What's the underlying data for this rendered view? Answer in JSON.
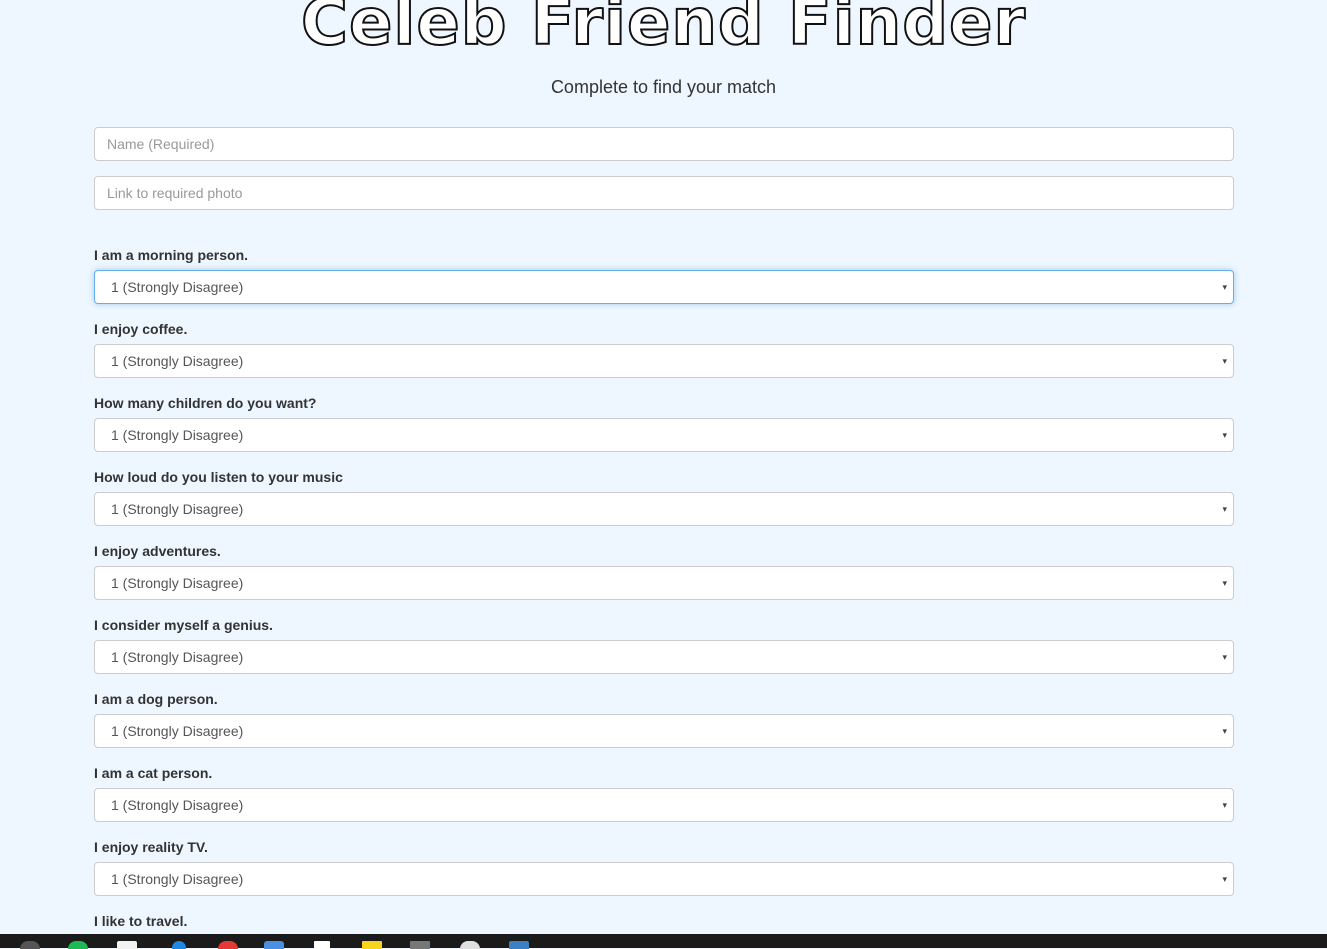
{
  "header": {
    "title": "Celeb Friend Finder",
    "subtitle": "Complete to find your match"
  },
  "form": {
    "name_placeholder": "Name (Required)",
    "photo_placeholder": "Link to required photo",
    "questions": [
      {
        "label": "I am a morning person.",
        "selected": "1 (Strongly Disagree)"
      },
      {
        "label": "I enjoy coffee.",
        "selected": "1 (Strongly Disagree)"
      },
      {
        "label": "How many children do you want?",
        "selected": "1 (Strongly Disagree)"
      },
      {
        "label": "How loud do you listen to your music",
        "selected": "1 (Strongly Disagree)"
      },
      {
        "label": "I enjoy adventures.",
        "selected": "1 (Strongly Disagree)"
      },
      {
        "label": "I consider myself a genius.",
        "selected": "1 (Strongly Disagree)"
      },
      {
        "label": "I am a dog person.",
        "selected": "1 (Strongly Disagree)"
      },
      {
        "label": "I am a cat person.",
        "selected": "1 (Strongly Disagree)"
      },
      {
        "label": "I enjoy reality TV.",
        "selected": "1 (Strongly Disagree)"
      },
      {
        "label": "I like to travel."
      }
    ]
  },
  "icons": {
    "select_caret": "▾"
  },
  "colors": {
    "background": "#eef6ff",
    "focus_border": "#66afe9",
    "text": "#333333",
    "taskbar": "#1b1b1b"
  },
  "taskbar": {
    "icons": [
      "start-icon",
      "spotify-icon",
      "file-icon",
      "edge-icon",
      "chrome-icon",
      "mail-icon",
      "store-icon",
      "sticky-notes-icon",
      "explorer-icon",
      "github-icon",
      "vscode-icon"
    ]
  }
}
